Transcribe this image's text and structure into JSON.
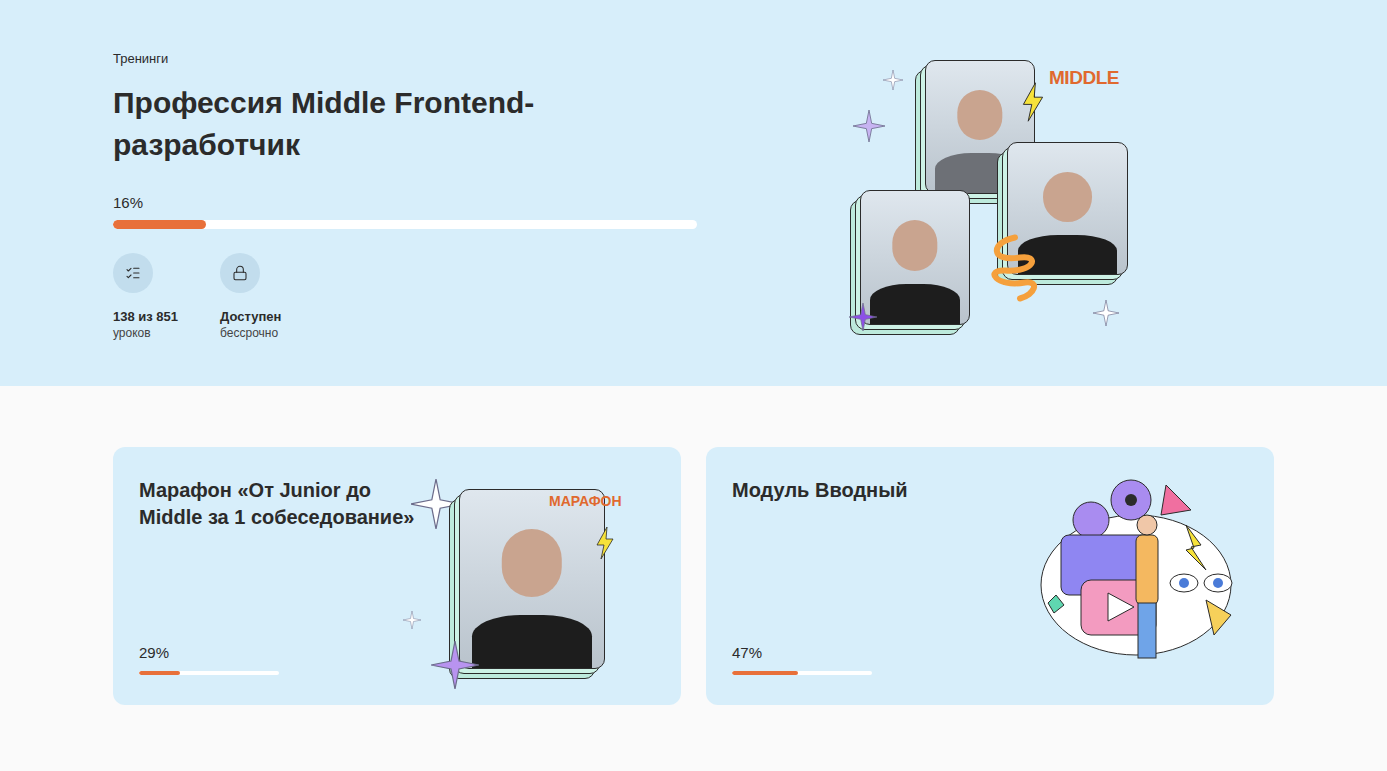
{
  "hero": {
    "category": "Тренинги",
    "title": "Профессия Middle Frontend-разработчик",
    "progress": {
      "reading": "16%",
      "level": 0.16
    },
    "stats": [
      {
        "value": "138 из 851",
        "label": "уроков",
        "kind": "lessons"
      },
      {
        "value": "Доступен",
        "label": "бессрочно",
        "kind": "access"
      }
    ],
    "badge": "MIDDLE"
  },
  "cards": [
    {
      "title": "Марафон «От Junior до Middle за 1 собеседование»",
      "kind": "photo",
      "badge": "МАРАФОН",
      "progress": {
        "reading": "29%",
        "level": 0.29
      }
    },
    {
      "title": "Модуль Вводный",
      "kind": "illustration",
      "progress": {
        "reading": "47%",
        "level": 0.47
      }
    }
  ]
}
